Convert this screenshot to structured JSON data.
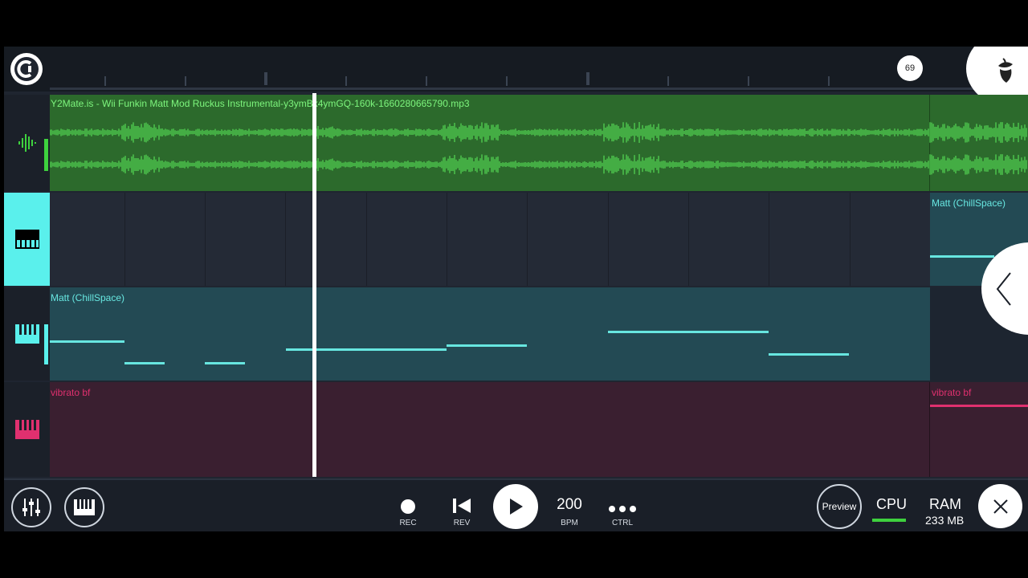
{
  "toolbar_top": {
    "badge_count": "69"
  },
  "tracks": {
    "audio": {
      "clip_label": "Y2Mate.is - Wii Funkin Matt Mod   Ruckus Instrumental-y3ymBk4ymGQ-160k-1660280665790.mp3",
      "color": "#2e8b2e"
    },
    "piano1": {
      "clip_label": "Matt (ChillSpace)"
    },
    "piano2": {
      "clip_label": "Matt (ChillSpace)"
    },
    "piano3": {
      "clip_label": "vibrato bf"
    },
    "piano4": {
      "clip_label": "vibrato bf"
    }
  },
  "transport": {
    "rec_label": "REC",
    "rev_label": "REV",
    "tempo_value": "200",
    "tempo_label": "BPM",
    "ctrl_label": "CTRL",
    "preview_label": "Preview",
    "cpu_label": "CPU",
    "ram_label": "RAM",
    "ram_value": "233 MB"
  },
  "colors": {
    "accent_cyan": "#5af0ec",
    "audio_green": "#3ed13e",
    "pink": "#e0306f"
  }
}
